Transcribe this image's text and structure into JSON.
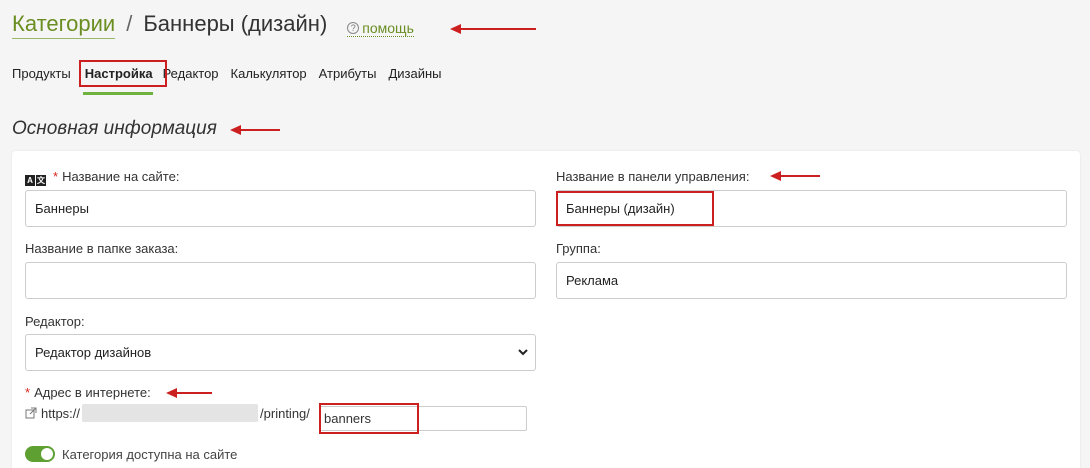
{
  "header": {
    "breadcrumb_link": "Категории",
    "separator": "/",
    "current": "Баннеры (дизайн)",
    "help_label": "помощь"
  },
  "tabs": [
    {
      "label": "Продукты"
    },
    {
      "label": "Настройка",
      "active": true
    },
    {
      "label": "Редактор"
    },
    {
      "label": "Калькулятор"
    },
    {
      "label": "Атрибуты"
    },
    {
      "label": "Дизайны"
    }
  ],
  "section": {
    "title": "Основная информация"
  },
  "form": {
    "site_name_label": "Название на сайте:",
    "site_name_value": "Баннеры",
    "admin_name_label": "Название в панели управления:",
    "admin_name_value": "Баннеры (дизайн)",
    "order_folder_label": "Название в папке заказа:",
    "order_folder_value": "",
    "group_label": "Группа:",
    "group_value": "Реклама",
    "editor_label": "Редактор:",
    "editor_value": "Редактор дизайнов",
    "address_label": "Адрес в интернете:",
    "url_prefix": "https://",
    "url_path": "/printing/",
    "url_slug": "banners",
    "toggle_label": "Категория доступна на сайте",
    "toggle_on": true
  },
  "colors": {
    "accent_green": "#6fb23e",
    "link_green": "#6b8e23",
    "annotation_red": "#cc1f1f",
    "required_red": "#d9251e"
  },
  "icons": [
    "help-circle-icon",
    "translate-icon",
    "chevron-down-icon",
    "external-link-icon"
  ]
}
